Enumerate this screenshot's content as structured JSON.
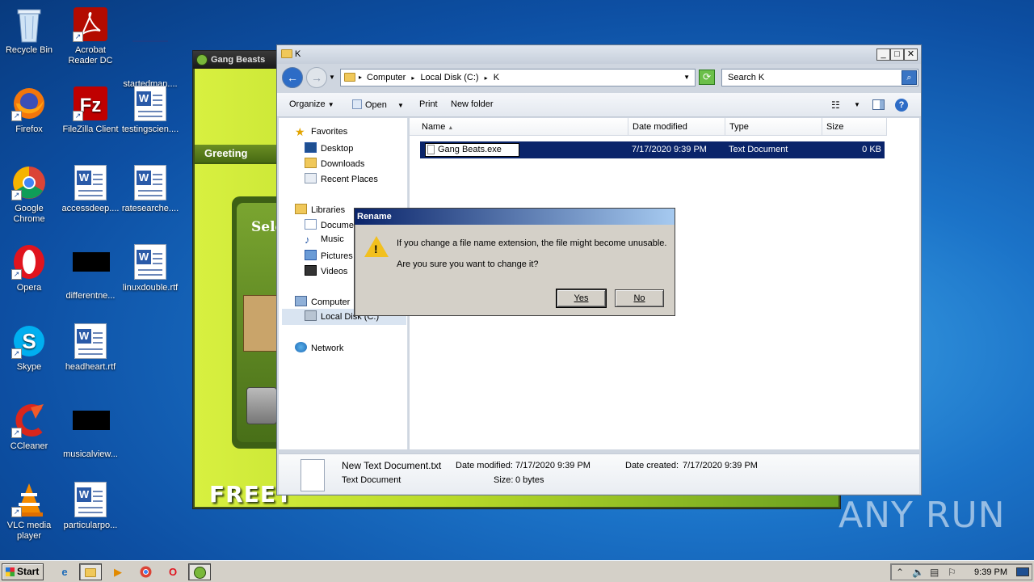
{
  "desktop": {
    "icons": [
      {
        "label": "Recycle Bin",
        "icon": "recycle-bin-icon"
      },
      {
        "label": "Firefox",
        "icon": "firefox-icon"
      },
      {
        "label": "Google Chrome",
        "icon": "chrome-icon"
      },
      {
        "label": "Opera",
        "icon": "opera-icon"
      },
      {
        "label": "Skype",
        "icon": "skype-icon"
      },
      {
        "label": "CCleaner",
        "icon": "ccleaner-icon"
      },
      {
        "label": "VLC media player",
        "icon": "vlc-icon"
      },
      {
        "label": "Acrobat Reader DC",
        "icon": "acrobat-icon"
      },
      {
        "label": "FileZilla Client",
        "icon": "filezilla-icon"
      },
      {
        "label": "accessdeep....",
        "icon": "word-doc-icon"
      },
      {
        "label": "differentne...",
        "icon": "black-thumbnail-icon"
      },
      {
        "label": "headheart.rtf",
        "icon": "word-doc-icon"
      },
      {
        "label": "musicalview...",
        "icon": "black-thumbnail-icon"
      },
      {
        "label": "particularpo...",
        "icon": "word-doc-icon"
      },
      {
        "label": "startedman....",
        "icon": "blank-icon"
      },
      {
        "label": "testingscien....",
        "icon": "word-doc-icon"
      },
      {
        "label": "ratesearche....",
        "icon": "word-doc-icon"
      },
      {
        "label": "linuxdouble.rtf",
        "icon": "word-doc-icon"
      }
    ]
  },
  "gang_beasts": {
    "title": "Gang Beasts",
    "greeting": "Greeting",
    "select_text": "Sele",
    "free_text": "FREET"
  },
  "explorer": {
    "title": "K",
    "breadcrumb": [
      "Computer",
      "Local Disk (C:)",
      "K"
    ],
    "search_placeholder": "Search K",
    "toolbar": {
      "organize": "Organize",
      "open": "Open",
      "print": "Print",
      "new_folder": "New folder"
    },
    "nav": {
      "favorites": "Favorites",
      "desktop": "Desktop",
      "downloads": "Downloads",
      "recent_places": "Recent Places",
      "libraries": "Libraries",
      "documents": "Documents",
      "music": "Music",
      "pictures": "Pictures",
      "videos": "Videos",
      "computer": "Computer",
      "local_disk": "Local Disk (C:)",
      "network": "Network"
    },
    "columns": {
      "name": "Name",
      "date_modified": "Date modified",
      "type": "Type",
      "size": "Size"
    },
    "file_row": {
      "name": "Gang Beats.exe",
      "date_modified": "7/17/2020 9:39 PM",
      "type": "Text Document",
      "size": "0 KB"
    },
    "details": {
      "filename": "New Text Document.txt",
      "date_modified_label": "Date modified:",
      "date_modified": "7/17/2020 9:39 PM",
      "date_created_label": "Date created:",
      "date_created": "7/17/2020 9:39 PM",
      "type": "Text Document",
      "size_label": "Size:",
      "size": "0 bytes"
    }
  },
  "dialog": {
    "title": "Rename",
    "message1": "If you change a file name extension, the file might become unusable.",
    "message2": "Are you sure you want to change it?",
    "yes": "Yes",
    "no": "No"
  },
  "watermark": "ANY RUN",
  "taskbar": {
    "start": "Start",
    "clock": "9:39 PM"
  }
}
